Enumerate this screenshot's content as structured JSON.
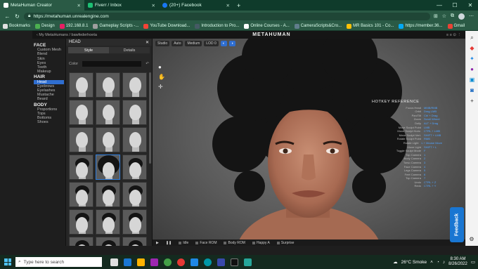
{
  "browser": {
    "tabs": [
      {
        "title": "MetaHuman Creator",
        "icon": "metahuman-icon",
        "active": true
      },
      {
        "title": "Fiverr / Inbox",
        "icon": "fiverr-icon",
        "active": false
      },
      {
        "title": "(20+) Facebook",
        "icon": "facebook-icon",
        "active": false
      }
    ],
    "url": "https://metahuman.unrealengine.com",
    "bookmarks": [
      {
        "label": "Bookmarks",
        "color": "#e0e0e0"
      },
      {
        "label": "Design",
        "color": "#4caf50"
      },
      {
        "label": "192.168.8.1",
        "color": "#e91e63"
      },
      {
        "label": "Gameplay Scripts -...",
        "color": "#9e9e9e"
      },
      {
        "label": "YouTube Download...",
        "color": "#f44336"
      },
      {
        "label": "Introduction to Pro...",
        "color": "#455a64"
      },
      {
        "label": "Online Courses - A...",
        "color": "#ffffff"
      },
      {
        "label": "CameraScripts&Cro...",
        "color": "#607d8b"
      },
      {
        "label": "MR Basics 101 - Co...",
        "color": "#ffc107"
      },
      {
        "label": "https://member.36...",
        "color": "#03a9f4"
      },
      {
        "label": "Gmail",
        "color": "#ea4335"
      }
    ]
  },
  "app": {
    "breadcrumb": "‹ My MetaHumans / bawfederhoeta",
    "logo": "METAHUMAN",
    "top_right": "≡ ≡ ⊙ ⋮",
    "nav": [
      {
        "section": "FACE",
        "items": [
          "Custom Mesh",
          "Blend",
          "Skin",
          "Eyes",
          "Teeth",
          "Makeup"
        ]
      },
      {
        "section": "HAIR",
        "items": [
          "Head",
          "Eyebrows",
          "Eyelashes",
          "Mustache",
          "Beard"
        ]
      },
      {
        "section": "BODY",
        "items": [
          "Proportions",
          "Tops",
          "Bottoms",
          "Shoes"
        ]
      }
    ],
    "selected_nav": "Head",
    "panel": {
      "title": "HEAD",
      "close": "✕",
      "tabs": [
        "Style",
        "Details"
      ],
      "active_tab": "Style",
      "color_label": "Color",
      "color_value": "#111111"
    },
    "viewport": {
      "toolbar": [
        "Studio",
        "Auto",
        "Medium",
        "LOD 0"
      ],
      "side_tools": [
        "●",
        "✋",
        "✛"
      ],
      "notes_title": "HOTKEY REFERENCE",
      "notes": [
        [
          "Focus Head",
          "MMB/RMB"
        ],
        [
          "Orbit",
          "Drag LMB"
        ],
        [
          "Pan/Tilt",
          "Ctrl + Drag"
        ],
        [
          "Zoom",
          "Scroll Wheel"
        ],
        [
          "Dolly",
          "ALT + Drag"
        ],
        [
          "Move Sculpt Point",
          "LMB"
        ],
        [
          "Move Sculpt Horiz.",
          "CTRL + LMB"
        ],
        [
          "Move Sculpt Vert.",
          "SHIFT + LMB"
        ],
        [
          "Rotate Sculpt Point",
          "RMB"
        ],
        [
          "Rotate Light",
          "L + Mouse Move"
        ],
        [
          "Move Light",
          "SHIFT + L"
        ],
        [
          "Toggle Sculpt Mode",
          "F"
        ],
        [
          "Top Camera",
          "1"
        ],
        [
          "Body Camera",
          "2"
        ],
        [
          "Torso Camera",
          "3"
        ],
        [
          "Face Camera",
          "4"
        ],
        [
          "Legs Camera",
          "5"
        ],
        [
          "Feet Camera",
          "6"
        ],
        [
          "Top Camera",
          "7"
        ],
        [
          "Undo",
          "CTRL + Z"
        ],
        [
          "Redo",
          "CTRL + Y"
        ]
      ]
    },
    "timeline": [
      {
        "label": "Idle"
      },
      {
        "label": "Face ROM"
      },
      {
        "label": "Body ROM"
      },
      {
        "label": "Happy A"
      },
      {
        "label": "Surprise"
      }
    ],
    "feedback": "Feedback"
  },
  "taskbar": {
    "search_placeholder": "Type here to search",
    "weather": "26°C Smoke",
    "time": "8:30 AM",
    "date": "8/26/2022"
  }
}
